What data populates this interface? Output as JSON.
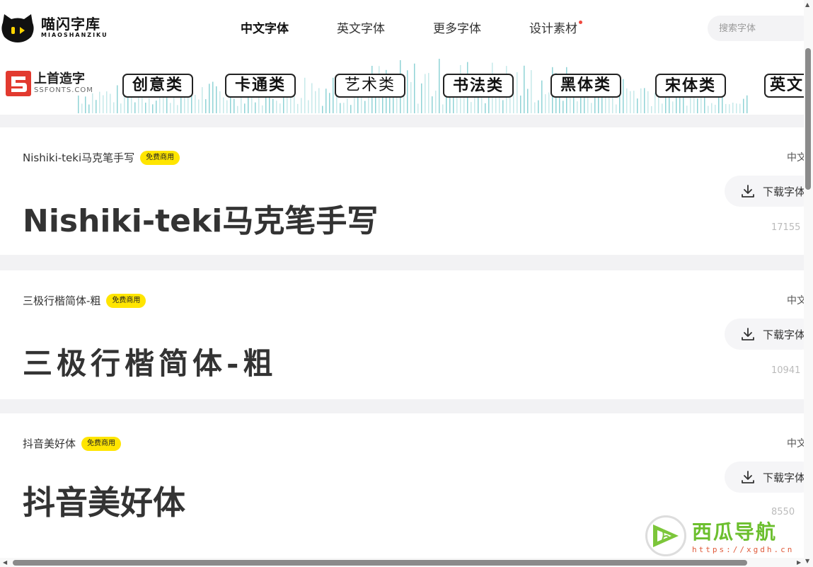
{
  "header": {
    "logo": {
      "name": "喵闪字库",
      "sub": "MIAOSHANZIKU"
    },
    "nav": [
      {
        "label": "中文字体",
        "active": true
      },
      {
        "label": "英文字体",
        "active": false
      },
      {
        "label": "更多字体",
        "active": false
      },
      {
        "label": "设计素材",
        "active": false,
        "dot": true
      }
    ],
    "search": {
      "placeholder": "搜索字体",
      "value": ""
    }
  },
  "banner": {
    "brand_cn": "上首造字",
    "brand_en": "SSFONTS.COM",
    "categories": [
      "创意类",
      "卡通类",
      "艺术类",
      "书法类",
      "黑体类",
      "宋体类",
      "英文"
    ]
  },
  "fonts": [
    {
      "name": "Nishiki-teki马克笔手写",
      "badge": "免费商用",
      "preview": "Nishiki-teki马克笔手写",
      "lang": "中文",
      "download": "下载字体",
      "count": "17155"
    },
    {
      "name": "三极行楷简体-粗",
      "badge": "免费商用",
      "preview": "三极行楷简体-粗",
      "lang": "中文",
      "download": "下载字体",
      "count": "10941"
    },
    {
      "name": "抖音美好体",
      "badge": "免费商用",
      "preview": "抖音美好体",
      "lang": "中文",
      "download": "下载字体",
      "count": "8550"
    }
  ],
  "watermark": {
    "title": "西瓜导航",
    "url": "https://xgdh.cn"
  },
  "colors": {
    "accent_yellow": "#ffe500",
    "nav_underline": "#ffe94d",
    "brand_red": "#e23a2f",
    "watermark_green": "#6cbf2e"
  }
}
